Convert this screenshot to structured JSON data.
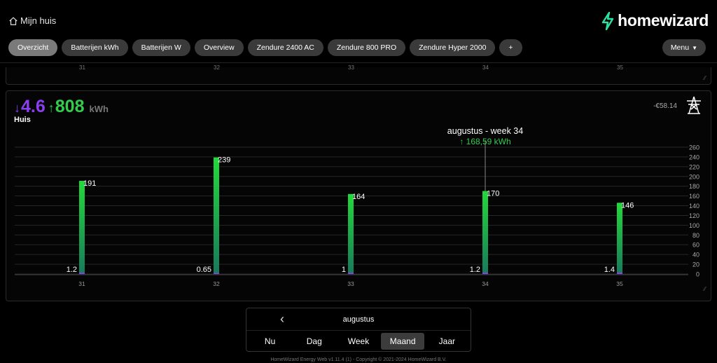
{
  "header": {
    "home_label": "Mijn huis",
    "logo_text": "homewizard",
    "menu_label": "Menu"
  },
  "tabs": [
    {
      "label": "Overzicht",
      "active": true
    },
    {
      "label": "Batterijen kWh"
    },
    {
      "label": "Batterijen W"
    },
    {
      "label": "Overview"
    },
    {
      "label": "Zendure 2400 AC"
    },
    {
      "label": "Zendure 800 PRO"
    },
    {
      "label": "Zendure Hyper 2000"
    },
    {
      "label": "+"
    }
  ],
  "top_card": {
    "ticks": [
      "31",
      "32",
      "33",
      "34",
      "35"
    ]
  },
  "card": {
    "import_arrow": "↓",
    "import_value": "4.6",
    "export_arrow": "↑",
    "export_value": "808",
    "unit": "kWh",
    "label": "Huis",
    "cost": "-€58.14",
    "resize_glyph": "⁄⁄"
  },
  "tooltip": {
    "title": "augustus - week 34",
    "value": "↑ 168,59 kWh"
  },
  "chart_data": {
    "type": "bar",
    "categories": [
      "31",
      "32",
      "33",
      "34",
      "35"
    ],
    "series": [
      {
        "values": [
          191,
          239,
          164,
          170,
          146
        ],
        "labels": [
          "191",
          "239",
          "164",
          "170",
          "146"
        ]
      },
      {
        "values": [
          1.2,
          0.65,
          1,
          1.2,
          1.4
        ],
        "labels": [
          "1.2",
          "0.65",
          "1",
          "1.2",
          "1.4"
        ]
      }
    ],
    "ylim": [
      0,
      260
    ],
    "yticks": [
      0,
      20,
      40,
      60,
      80,
      100,
      120,
      140,
      160,
      180,
      200,
      220,
      240,
      260
    ],
    "grid": true,
    "highlight_index": 3
  },
  "colors": {
    "import": "#8b3ff0",
    "export": "#33cc4d",
    "bar_top": "#22d93a",
    "bar_bottom": "#177a5c"
  },
  "nav": {
    "month": "augustus",
    "prev_icon": "chevron-left-icon",
    "periods": [
      {
        "label": "Nu"
      },
      {
        "label": "Dag"
      },
      {
        "label": "Week"
      },
      {
        "label": "Maand",
        "active": true
      },
      {
        "label": "Jaar"
      }
    ]
  },
  "footer": {
    "text": "HomeWizard Energy Web v1.11.4 (1) - Copyright © 2021-2024 HomeWizard B.V."
  }
}
